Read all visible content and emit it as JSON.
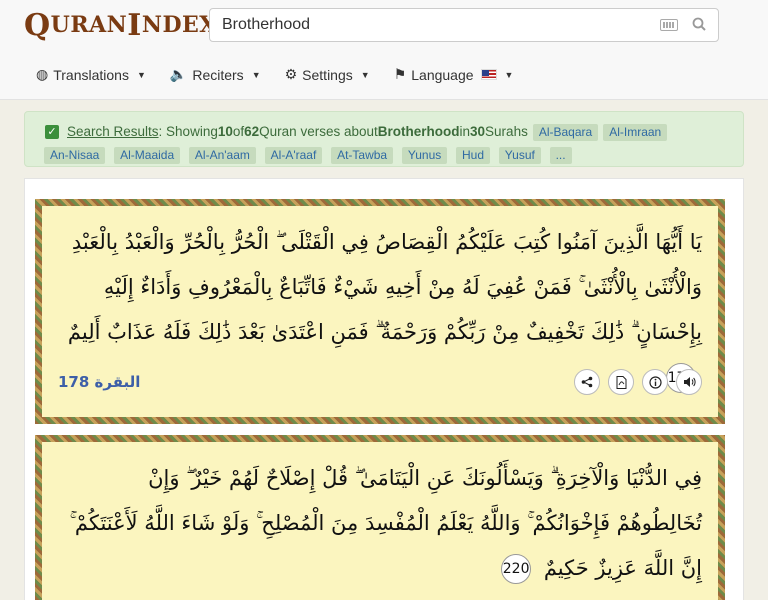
{
  "logo": {
    "text_q": "Q",
    "text_uran": "URAN ",
    "text_i": "I",
    "text_ndex": "NDEX",
    "mark": "✗"
  },
  "search": {
    "value": "Brotherhood",
    "keyboard_icon": "keyboard-icon",
    "search_icon": "search-icon"
  },
  "nav": [
    {
      "icon": "globe-icon",
      "glyph": "◍",
      "label": "Translations"
    },
    {
      "icon": "speaker-icon",
      "glyph": "🔈",
      "label": "Reciters"
    },
    {
      "icon": "gear-icon",
      "glyph": "⚙",
      "label": "Settings"
    },
    {
      "icon": "flag-icon",
      "glyph": "⚑",
      "label": "Language"
    }
  ],
  "results": {
    "link": "Search Results",
    "text_a": ": Showing ",
    "shown": "10",
    "text_b": " of ",
    "total": "62",
    "text_c": " Quran verses about ",
    "topic": "Brotherhood",
    "text_d": " in ",
    "surahs": "30",
    "text_e": " Surahs",
    "tags": [
      "Al-Baqara",
      "Al-Imraan",
      "An-Nisaa",
      "Al-Maaida",
      "Al-An'aam",
      "Al-A'raaf",
      "At-Tawba",
      "Yunus",
      "Hud",
      "Yusuf",
      "..."
    ]
  },
  "verses": [
    {
      "arabic": "يَا أَيُّهَا الَّذِينَ آمَنُوا كُتِبَ عَلَيْكُمُ الْقِصَاصُ فِي الْقَتْلَى ۖ الْحُرُّ بِالْحُرِّ وَالْعَبْدُ بِالْعَبْدِ وَالْأُنْثَىٰ بِالْأُنْثَىٰ ۚ فَمَنْ عُفِيَ لَهُ مِنْ أَخِيهِ شَيْءٌ فَاتِّبَاعٌ بِالْمَعْرُوفِ وَأَدَاءٌ إِلَيْهِ بِإِحْسَانٍ ۗ ذَٰلِكَ تَخْفِيفٌ مِنْ رَبِّكُمْ وَرَحْمَةٌ ۗ فَمَنِ اعْتَدَىٰ بَعْدَ ذَٰلِكَ فَلَهُ عَذَابٌ أَلِيمٌ",
      "number": "178",
      "reference": "البقرة 178"
    },
    {
      "arabic": "فِي الدُّنْيَا وَالْآخِرَةِ ۗ وَيَسْأَلُونَكَ عَنِ الْيَتَامَىٰ ۖ قُلْ إِصْلَاحٌ لَهُمْ خَيْرٌ ۖ وَإِنْ تُخَالِطُوهُمْ فَإِخْوَانُكُمْ ۚ وَاللَّهُ يَعْلَمُ الْمُفْسِدَ مِنَ الْمُصْلِحِ ۚ وَلَوْ شَاءَ اللَّهُ لَأَعْنَتَكُمْ ۚ إِنَّ اللَّهَ عَزِيزٌ حَكِيمٌ",
      "number": "220"
    }
  ],
  "action_icons": [
    "share-icon",
    "pdf-icon",
    "info-icon",
    "audio-icon"
  ]
}
